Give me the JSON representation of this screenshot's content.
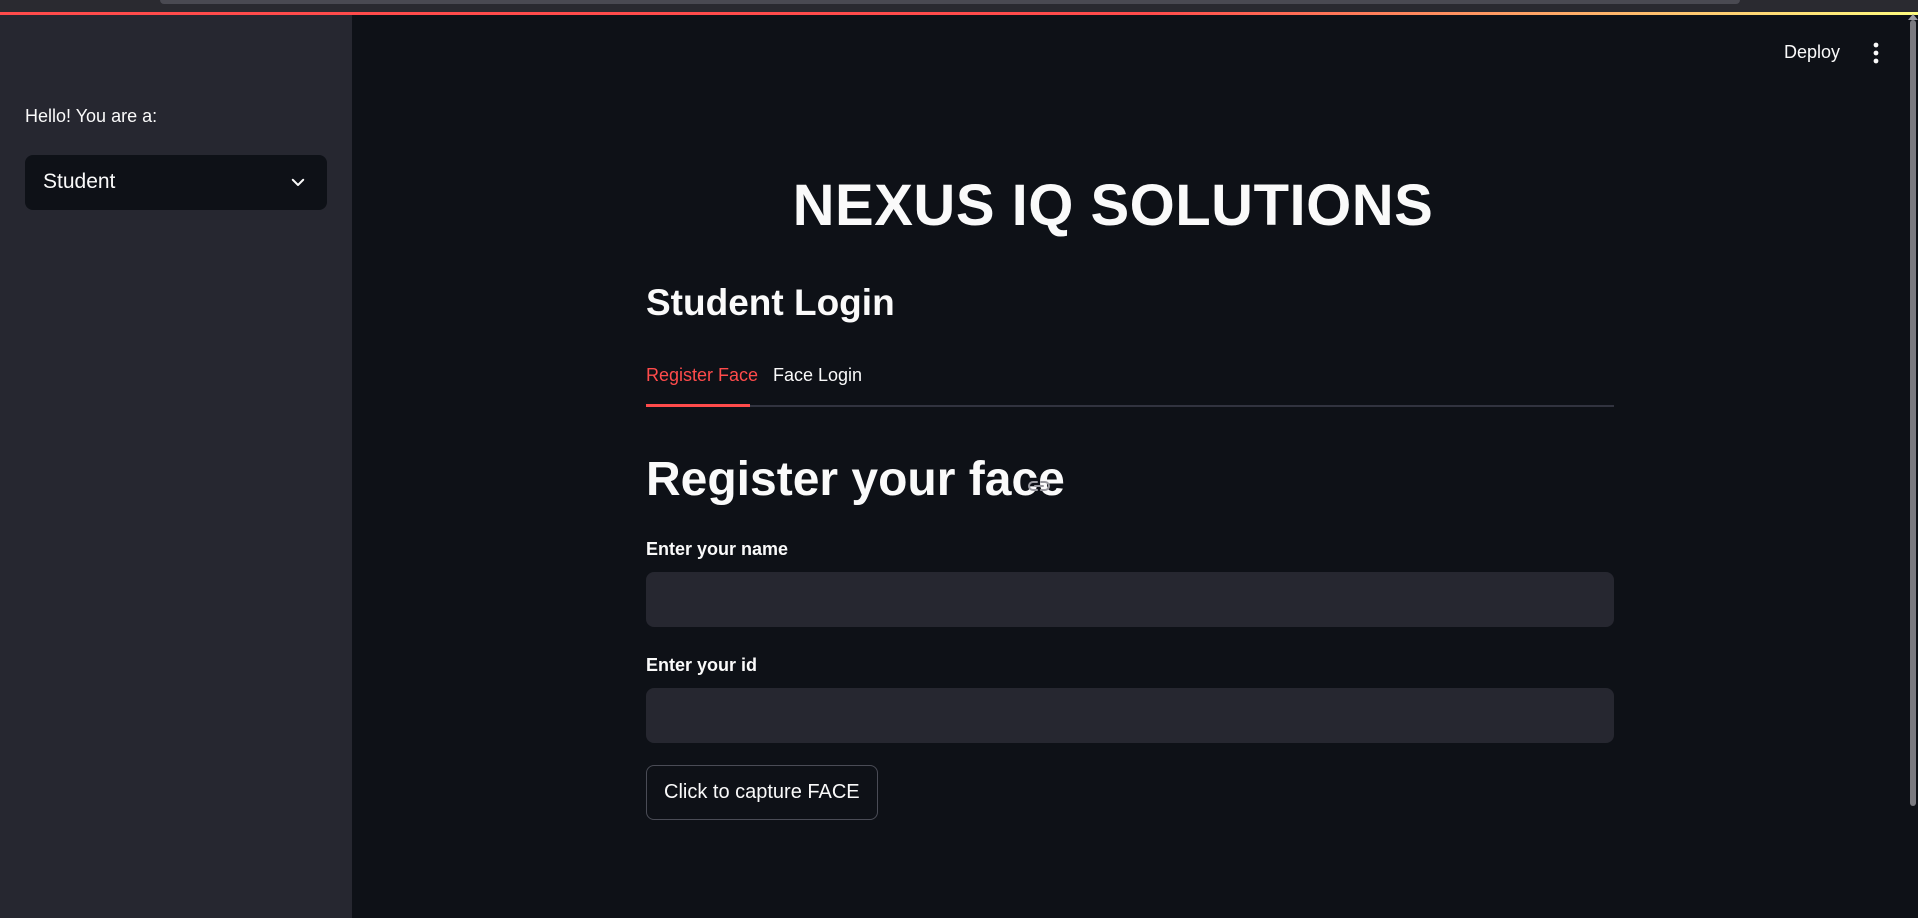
{
  "sidebar": {
    "label": "Hello! You are a:",
    "select": {
      "selected": "Student"
    }
  },
  "header": {
    "deploy_label": "Deploy",
    "menu_icon": "more-vertical-icon"
  },
  "main": {
    "title": "NEXUS IQ SOLUTIONS",
    "subtitle": "Student Login",
    "tabs": [
      {
        "label": "Register Face",
        "active": true
      },
      {
        "label": "Face Login",
        "active": false
      }
    ],
    "section": {
      "heading": "Register your face",
      "anchor_icon": "link-icon",
      "fields": [
        {
          "label": "Enter your name",
          "value": ""
        },
        {
          "label": "Enter your id",
          "value": ""
        }
      ],
      "button_label": "Click to capture FACE"
    }
  },
  "colors": {
    "accent": "#ff4b4b",
    "background": "#0e1117",
    "sidebar": "#262730",
    "text": "#fafafa"
  }
}
